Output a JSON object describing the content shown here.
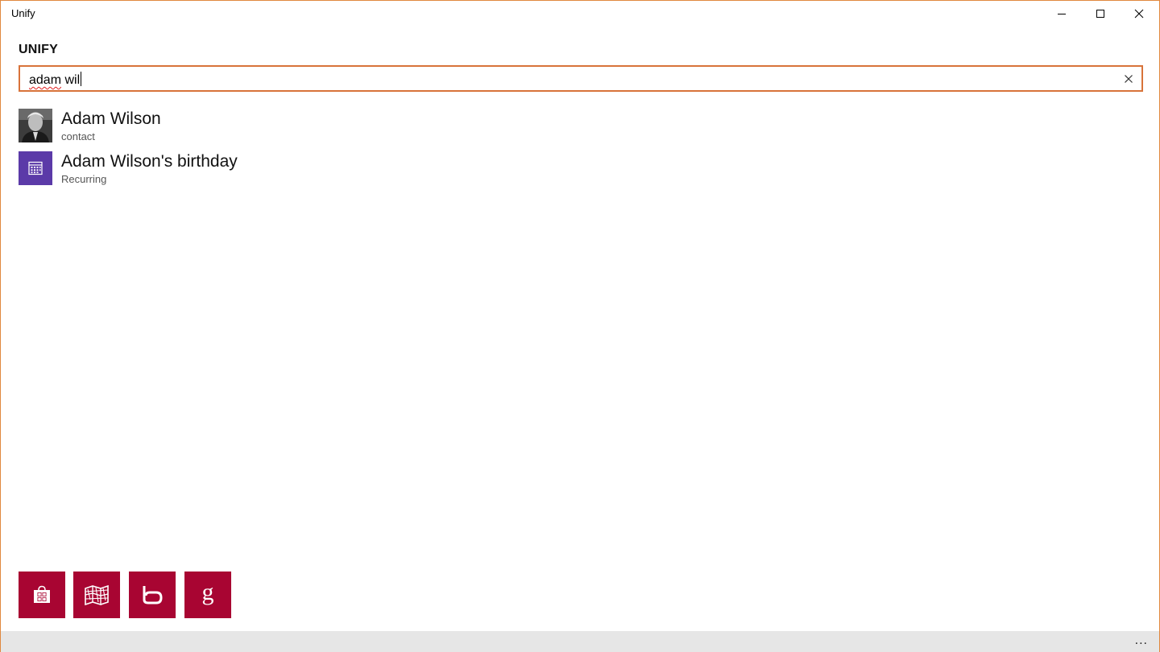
{
  "window": {
    "title": "Unify",
    "accent_border": "#e0883f"
  },
  "app": {
    "heading": "UNIFY"
  },
  "search": {
    "query_misspelled": "adam",
    "query_rest": " wil",
    "clear_icon": "close-icon"
  },
  "results": [
    {
      "title": "Adam Wilson",
      "subtitle": "contact",
      "icon": "contact-photo"
    },
    {
      "title": "Adam Wilson's birthday",
      "subtitle": "Recurring",
      "icon": "calendar-icon"
    }
  ],
  "tiles": [
    {
      "name": "store",
      "icon": "store-bag-icon",
      "color": "#a80532"
    },
    {
      "name": "maps",
      "icon": "maps-icon",
      "color": "#a80532"
    },
    {
      "name": "bing",
      "icon": "bing-icon",
      "color": "#a80532"
    },
    {
      "name": "google",
      "icon": "google-icon",
      "color": "#a80532"
    }
  ],
  "appbar": {
    "more_label": "..."
  }
}
